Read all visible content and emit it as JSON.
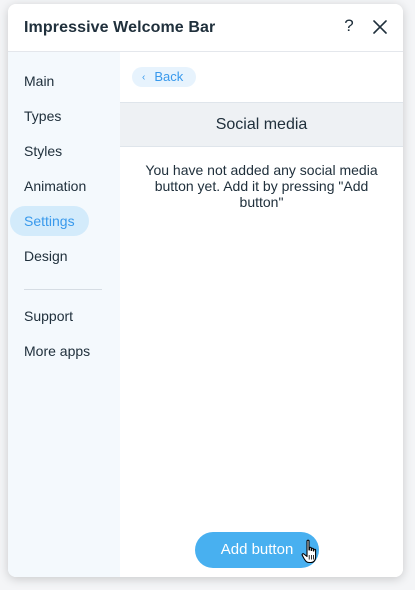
{
  "header": {
    "title": "Impressive Welcome Bar",
    "help_glyph": "?"
  },
  "sidebar": {
    "items": [
      {
        "label": "Main"
      },
      {
        "label": "Types"
      },
      {
        "label": "Styles"
      },
      {
        "label": "Animation"
      },
      {
        "label": "Settings",
        "active": true
      },
      {
        "label": "Design"
      }
    ],
    "secondary": [
      {
        "label": "Support"
      },
      {
        "label": "More apps"
      }
    ]
  },
  "content": {
    "back_label": "Back",
    "section_title": "Social media",
    "empty_message": "You have not added any social media button yet. Add it by pressing \"Add button\"",
    "add_button_label": "Add button"
  },
  "colors": {
    "accent": "#3899ec",
    "active_nav_bg": "#d3ebfb",
    "primary_button": "#48b0f0",
    "text": "#20303c"
  }
}
